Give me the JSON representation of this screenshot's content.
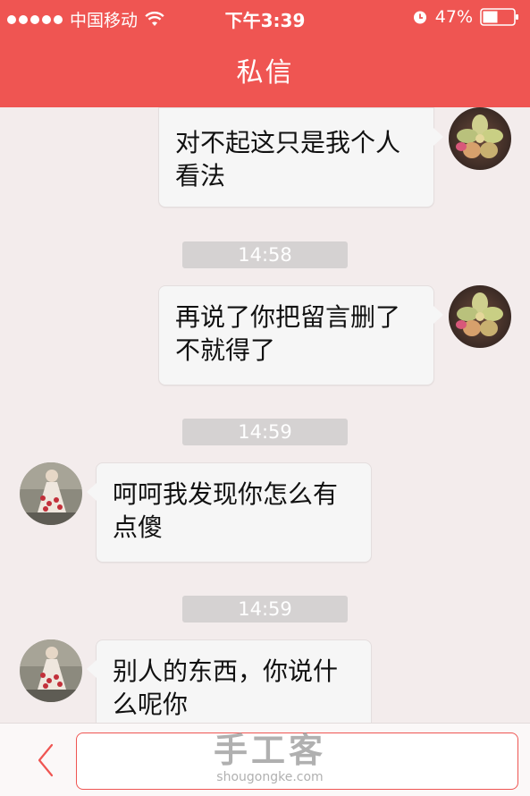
{
  "status_bar": {
    "carrier": "中国移动",
    "time": "下午3:39",
    "battery": "47%"
  },
  "header": {
    "title": "私信"
  },
  "messages": [
    {
      "side": "right",
      "text": "对不起这只是我个人看法"
    },
    {
      "timestamp": "14:58"
    },
    {
      "side": "right",
      "text": "再说了你把留言删了不就得了"
    },
    {
      "timestamp": "14:59"
    },
    {
      "side": "left",
      "text": "呵呵我发现你怎么有点傻"
    },
    {
      "timestamp": "14:59"
    },
    {
      "side": "left",
      "text": "别人的东西，你说什么呢你"
    }
  ],
  "composer": {
    "value": ""
  },
  "watermark": {
    "brand": "手工客",
    "domain": "shougongke.com"
  },
  "colors": {
    "accent": "#ef5552",
    "background": "#f3ecec",
    "bubble": "#f6f6f6",
    "timestamp_bg": "#d5d2d2"
  },
  "icons": [
    "wifi-icon",
    "alarm-icon",
    "battery-icon",
    "back-chevron-icon"
  ]
}
